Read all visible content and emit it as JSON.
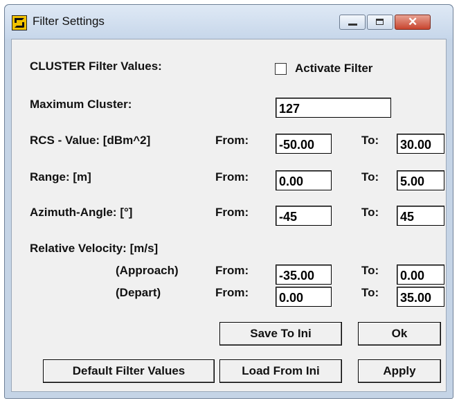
{
  "window": {
    "title": "Filter Settings"
  },
  "titlebar_buttons": {
    "minimize_icon": "minimize-icon",
    "maximize_icon": "maximize-icon",
    "close_glyph": "✕"
  },
  "form": {
    "cluster_filter_label": "CLUSTER Filter Values:",
    "activate_filter_label": "Activate Filter",
    "activate_filter_checked": false,
    "maximum_cluster_label": "Maximum Cluster:",
    "maximum_cluster_value": "127",
    "rcs": {
      "label": "RCS - Value: [dBm^2]",
      "from_label": "From:",
      "from_value": "-50.00",
      "to_label": "To:",
      "to_value": "30.00"
    },
    "range": {
      "label": "Range: [m]",
      "from_label": "From:",
      "from_value": "0.00",
      "to_label": "To:",
      "to_value": "5.00"
    },
    "azimuth": {
      "label": "Azimuth-Angle: [°]",
      "from_label": "From:",
      "from_value": "-45",
      "to_label": "To:",
      "to_value": "45"
    },
    "velocity": {
      "label": "Relative Velocity: [m/s]",
      "approach": {
        "label": "(Approach)",
        "from_label": "From:",
        "from_value": "-35.00",
        "to_label": "To:",
        "to_value": "0.00"
      },
      "depart": {
        "label": "(Depart)",
        "from_label": "From:",
        "from_value": "0.00",
        "to_label": "To:",
        "to_value": "35.00"
      }
    }
  },
  "buttons": {
    "save_to_ini": "Save To Ini",
    "ok": "Ok",
    "default_filter_values": "Default Filter Values",
    "load_from_ini": "Load From Ini",
    "apply": "Apply"
  }
}
